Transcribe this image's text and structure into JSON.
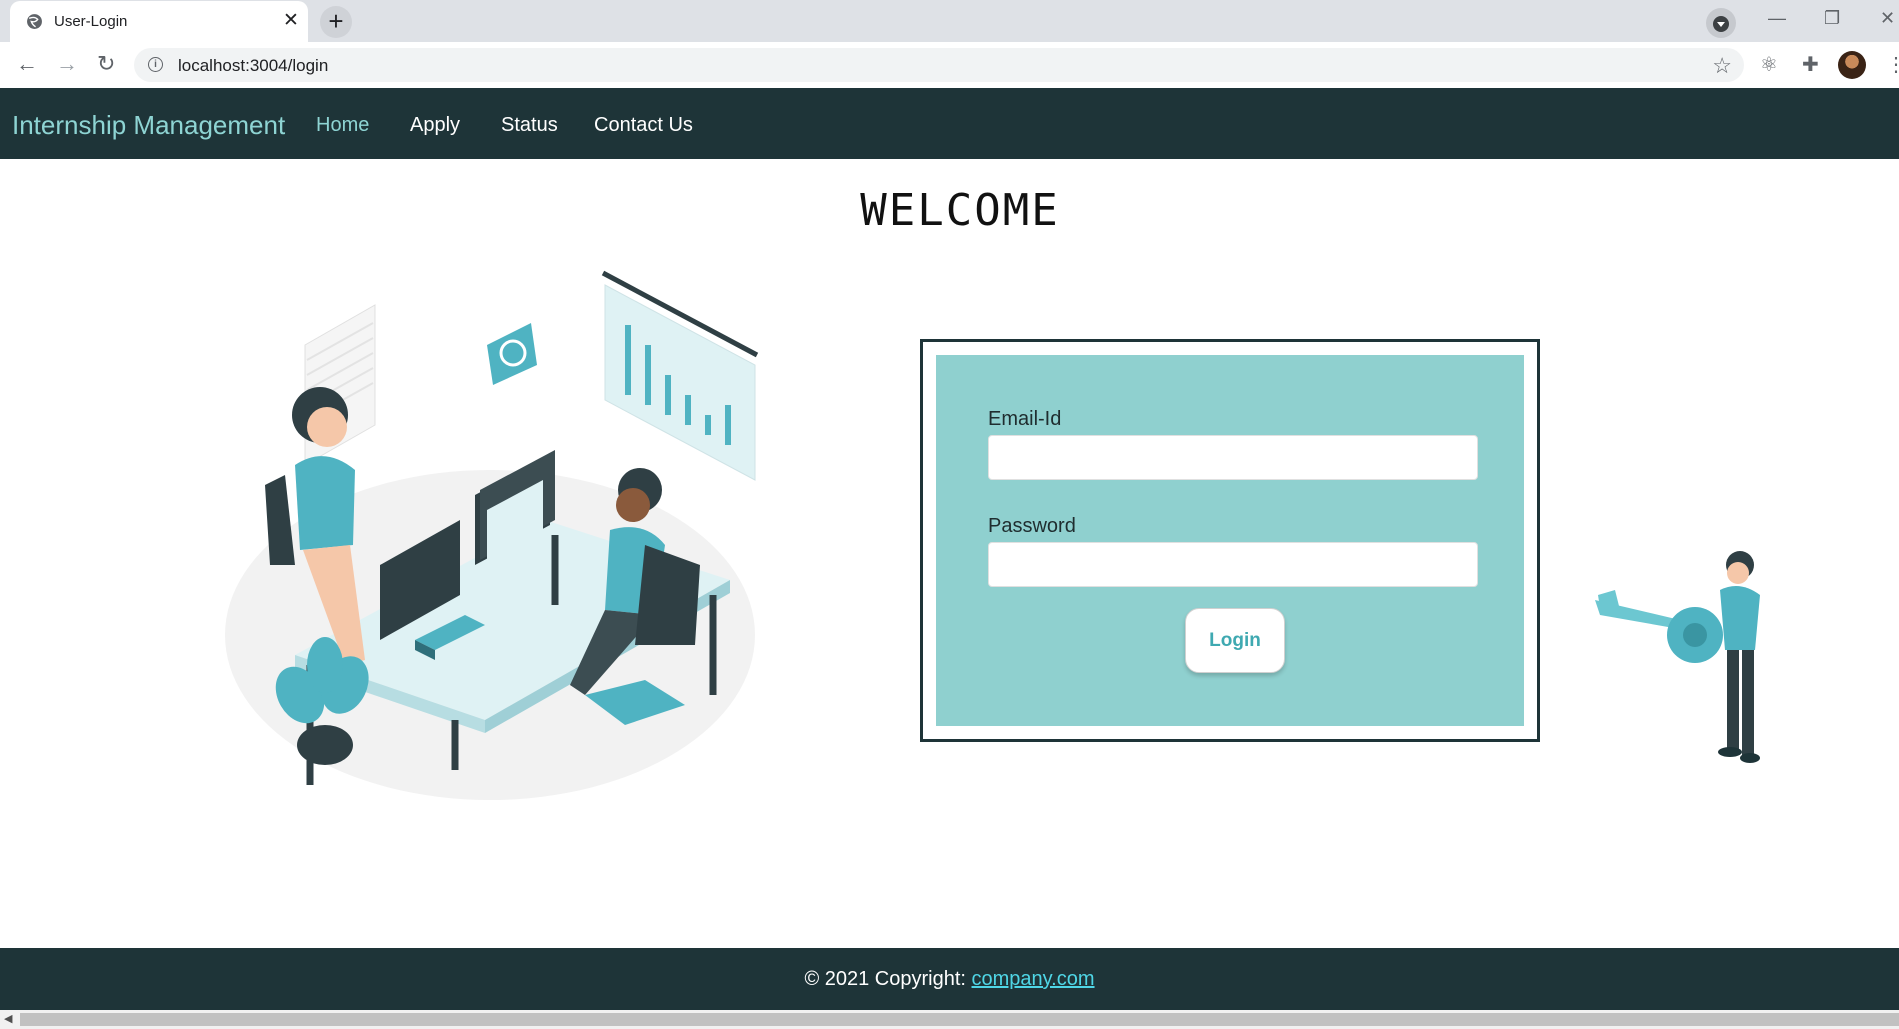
{
  "browser": {
    "tab_title": "User-Login",
    "tab_close": "✕",
    "new_tab": "+",
    "url": "localhost:3004/login",
    "icons": [
      "globe-icon",
      "back-icon",
      "forward-icon",
      "reload-icon",
      "info-icon",
      "star-icon",
      "extension-icon",
      "puzzle-icon",
      "avatar",
      "menu-icon"
    ]
  },
  "navbar": {
    "brand": "Internship Management",
    "links": [
      "Home",
      "Apply",
      "Status",
      "Contact Us"
    ],
    "active": "Home"
  },
  "main": {
    "heading": "WELCOME",
    "form": {
      "email_label": "Email-Id",
      "email_value": "",
      "password_label": "Password",
      "password_value": "",
      "login_label": "Login"
    }
  },
  "footer": {
    "text": "© 2021 Copyright:",
    "link": "company.com"
  },
  "colors": {
    "navbar_bg": "#1e3438",
    "accent": "#8ed4d3",
    "form_bg": "#8fd0cf",
    "button_text": "#3fa9b1"
  }
}
